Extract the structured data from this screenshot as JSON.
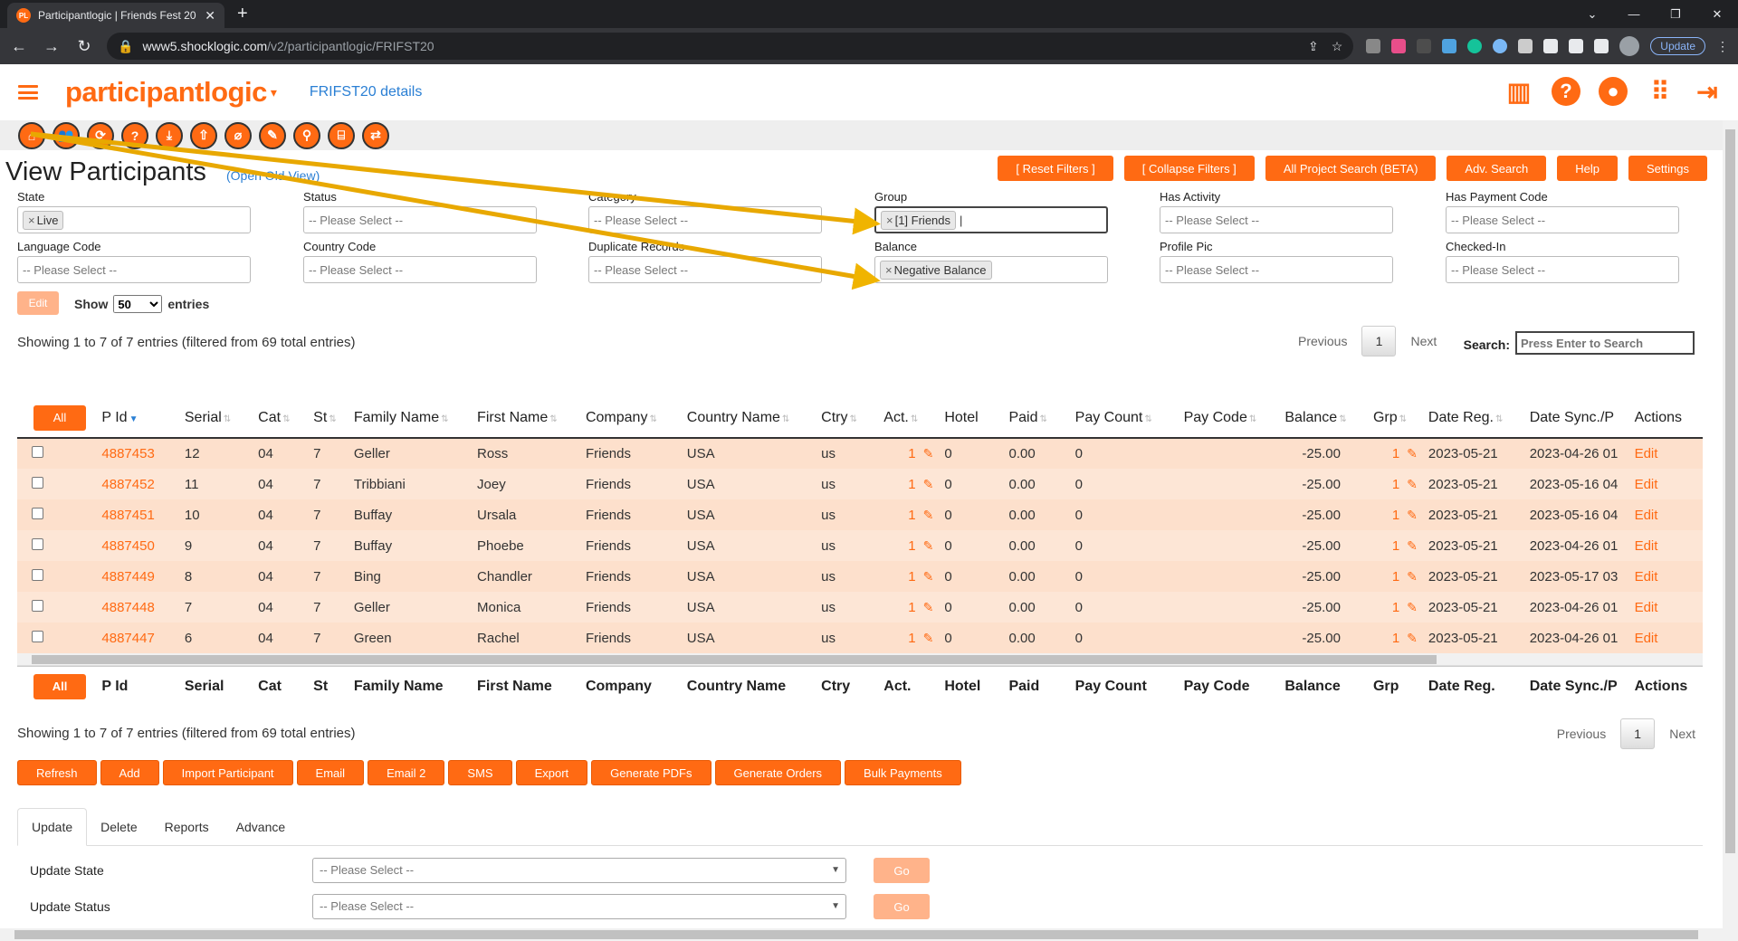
{
  "browser": {
    "tab_title": "Participantlogic | Friends Fest 20",
    "favicon": "PL",
    "url_host": "www5.shocklogic.com",
    "url_path": "/v2/participantlogic/FRIFST20",
    "update_label": "Update"
  },
  "header": {
    "logo": "participantlogic",
    "project_link": "FRIFST20 details",
    "accent": "#ff6a13"
  },
  "page": {
    "title": "View Participants",
    "old_view_link": "(Open Old View)"
  },
  "top_buttons": [
    "[ Reset Filters ]",
    "[ Collapse Filters ]",
    "All Project Search (BETA)",
    "Adv. Search",
    "Help",
    "Settings"
  ],
  "filters": {
    "state": {
      "label": "State",
      "chip": "Live"
    },
    "status": {
      "label": "Status",
      "placeholder": "-- Please Select --"
    },
    "category": {
      "label": "Category",
      "placeholder": "-- Please Select --"
    },
    "group": {
      "label": "Group",
      "chip": "[1] Friends"
    },
    "has_activity": {
      "label": "Has Activity",
      "placeholder": "-- Please Select --"
    },
    "has_payment_code": {
      "label": "Has Payment Code",
      "placeholder": "-- Please Select --"
    },
    "language_code": {
      "label": "Language Code",
      "placeholder": "-- Please Select --"
    },
    "country_code": {
      "label": "Country Code",
      "placeholder": "-- Please Select --"
    },
    "duplicate_records": {
      "label": "Duplicate Records",
      "placeholder": "-- Please Select --"
    },
    "balance": {
      "label": "Balance",
      "chip": "Negative Balance"
    },
    "profile_pic": {
      "label": "Profile Pic",
      "placeholder": "-- Please Select --"
    },
    "checked_in": {
      "label": "Checked-In",
      "placeholder": "-- Please Select --"
    }
  },
  "controls": {
    "edit_label": "Edit",
    "show_label": "Show",
    "entries_value": "50",
    "entries_label": "entries",
    "info": "Showing 1 to 7 of 7 entries (filtered from 69 total entries)",
    "previous": "Previous",
    "page": "1",
    "next": "Next",
    "search_label": "Search:",
    "search_placeholder": "Press Enter to Search"
  },
  "table": {
    "all_label": "All",
    "columns": [
      "P Id",
      "Serial",
      "Cat",
      "St",
      "Family Name",
      "First Name",
      "Company",
      "Country Name",
      "Ctry",
      "Act.",
      "Hotel",
      "Paid",
      "Pay Count",
      "Pay Code",
      "Balance",
      "Grp",
      "Date Reg.",
      "Date Sync./P",
      "Actions"
    ],
    "rows": [
      {
        "pid": "4887453",
        "serial": "12",
        "cat": "04",
        "st": "7",
        "family": "Geller",
        "first": "Ross",
        "company": "Friends",
        "country": "USA",
        "ctry": "us",
        "act": "1",
        "hotel": "0",
        "paid": "0.00",
        "paycount": "0",
        "paycode": "",
        "balance": "-25.00",
        "grp": "1",
        "datereg": "2023-05-21",
        "datesync": "2023-04-26 01",
        "action": "Edit"
      },
      {
        "pid": "4887452",
        "serial": "11",
        "cat": "04",
        "st": "7",
        "family": "Tribbiani",
        "first": "Joey",
        "company": "Friends",
        "country": "USA",
        "ctry": "us",
        "act": "1",
        "hotel": "0",
        "paid": "0.00",
        "paycount": "0",
        "paycode": "",
        "balance": "-25.00",
        "grp": "1",
        "datereg": "2023-05-21",
        "datesync": "2023-05-16 04",
        "action": "Edit"
      },
      {
        "pid": "4887451",
        "serial": "10",
        "cat": "04",
        "st": "7",
        "family": "Buffay",
        "first": "Ursala",
        "company": "Friends",
        "country": "USA",
        "ctry": "us",
        "act": "1",
        "hotel": "0",
        "paid": "0.00",
        "paycount": "0",
        "paycode": "",
        "balance": "-25.00",
        "grp": "1",
        "datereg": "2023-05-21",
        "datesync": "2023-05-16 04",
        "action": "Edit"
      },
      {
        "pid": "4887450",
        "serial": "9",
        "cat": "04",
        "st": "7",
        "family": "Buffay",
        "first": "Phoebe",
        "company": "Friends",
        "country": "USA",
        "ctry": "us",
        "act": "1",
        "hotel": "0",
        "paid": "0.00",
        "paycount": "0",
        "paycode": "",
        "balance": "-25.00",
        "grp": "1",
        "datereg": "2023-05-21",
        "datesync": "2023-04-26 01",
        "action": "Edit"
      },
      {
        "pid": "4887449",
        "serial": "8",
        "cat": "04",
        "st": "7",
        "family": "Bing",
        "first": "Chandler",
        "company": "Friends",
        "country": "USA",
        "ctry": "us",
        "act": "1",
        "hotel": "0",
        "paid": "0.00",
        "paycount": "0",
        "paycode": "",
        "balance": "-25.00",
        "grp": "1",
        "datereg": "2023-05-21",
        "datesync": "2023-05-17 03",
        "action": "Edit"
      },
      {
        "pid": "4887448",
        "serial": "7",
        "cat": "04",
        "st": "7",
        "family": "Geller",
        "first": "Monica",
        "company": "Friends",
        "country": "USA",
        "ctry": "us",
        "act": "1",
        "hotel": "0",
        "paid": "0.00",
        "paycount": "0",
        "paycode": "",
        "balance": "-25.00",
        "grp": "1",
        "datereg": "2023-05-21",
        "datesync": "2023-04-26 01",
        "action": "Edit"
      },
      {
        "pid": "4887447",
        "serial": "6",
        "cat": "04",
        "st": "7",
        "family": "Green",
        "first": "Rachel",
        "company": "Friends",
        "country": "USA",
        "ctry": "us",
        "act": "1",
        "hotel": "0",
        "paid": "0.00",
        "paycount": "0",
        "paycode": "",
        "balance": "-25.00",
        "grp": "1",
        "datereg": "2023-05-21",
        "datesync": "2023-04-26 01",
        "action": "Edit"
      }
    ]
  },
  "action_buttons": [
    "Refresh",
    "Add",
    "Import Participant",
    "Email",
    "Email 2",
    "SMS",
    "Export",
    "Generate PDFs",
    "Generate Orders",
    "Bulk Payments"
  ],
  "bottom_tabs": [
    "Update",
    "Delete",
    "Reports",
    "Advance"
  ],
  "update_rows": [
    {
      "label": "Update State",
      "placeholder": "-- Please Select --",
      "go": "Go"
    },
    {
      "label": "Update Status",
      "placeholder": "-- Please Select --",
      "go": "Go"
    }
  ],
  "annotation_color": "#f0b400"
}
